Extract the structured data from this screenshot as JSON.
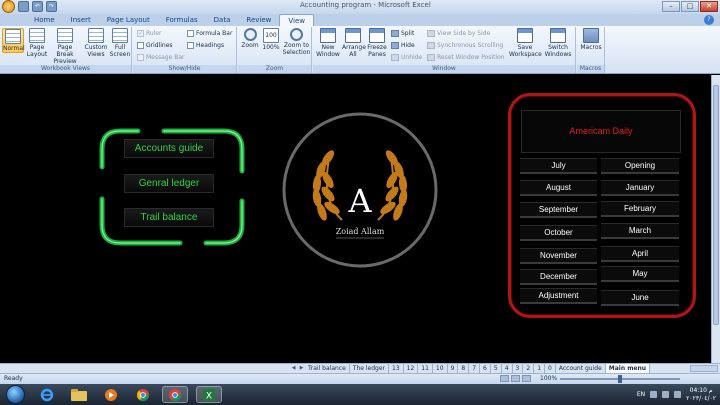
{
  "window": {
    "title": "Accounting program - Microsoft Excel",
    "controls": {
      "minimize": "–",
      "maximize": "□",
      "close": "✕"
    }
  },
  "ribbon": {
    "tabs": [
      "Home",
      "Insert",
      "Page Layout",
      "Formulas",
      "Data",
      "Review",
      "View"
    ],
    "active_tab": "View",
    "groups": {
      "workbook_views": {
        "name": "Workbook Views",
        "buttons": [
          "Normal",
          "Page Layout",
          "Page Break Preview",
          "Custom Views",
          "Full Screen"
        ]
      },
      "show_hide": {
        "name": "Show/Hide",
        "checks": [
          {
            "label": "Ruler",
            "checked": true,
            "disabled": true
          },
          {
            "label": "Gridlines",
            "checked": false,
            "disabled": false
          },
          {
            "label": "Message Bar",
            "checked": false,
            "disabled": true
          },
          {
            "label": "Formula Bar",
            "checked": false,
            "disabled": false
          },
          {
            "label": "Headings",
            "checked": false,
            "disabled": false
          }
        ]
      },
      "zoom": {
        "name": "Zoom",
        "buttons": [
          "Zoom",
          "100%",
          "Zoom to Selection"
        ]
      },
      "window": {
        "name": "Window",
        "buttons": [
          "New Window",
          "Arrange All",
          "Freeze Panes"
        ],
        "small": [
          {
            "label": "Split",
            "disabled": false
          },
          {
            "label": "Hide",
            "disabled": false
          },
          {
            "label": "Unhide",
            "disabled": true
          },
          {
            "label": "View Side by Side",
            "disabled": true
          },
          {
            "label": "Synchronous Scrolling",
            "disabled": true
          },
          {
            "label": "Reset Window Position",
            "disabled": true
          }
        ],
        "buttons2": [
          "Save Workspace",
          "Switch Windows"
        ]
      },
      "macros": {
        "name": "Macros",
        "buttons": [
          "Macros"
        ]
      }
    }
  },
  "green_menu": {
    "items": [
      "Accounts guide",
      "Genral ledger",
      "Trail balance"
    ],
    "color": "#2bd24a"
  },
  "logo": {
    "letter": "A",
    "name": "Zoiad Allam"
  },
  "americam_daily": {
    "title": "Americam Daily",
    "left_months": [
      "July",
      "August",
      "September",
      "October",
      "November",
      "December",
      "Adjustment"
    ],
    "right_months": [
      "Opening",
      "January",
      "February",
      "March",
      "April",
      "May",
      "June"
    ],
    "color": "#b01616"
  },
  "sheet_tabs": [
    "Trail balance",
    "The ledger",
    "13",
    "12",
    "11",
    "10",
    "9",
    "8",
    "7",
    "6",
    "5",
    "4",
    "3",
    "2",
    "1",
    "0",
    "Account guide",
    "Main menu"
  ],
  "active_sheet": "Main menu",
  "status": {
    "text": "Ready",
    "zoom": "100%"
  },
  "taskbar": {
    "language": "EN",
    "time": "04:10 م",
    "date": "٢٠٢٣/٠٤/٠٢"
  }
}
